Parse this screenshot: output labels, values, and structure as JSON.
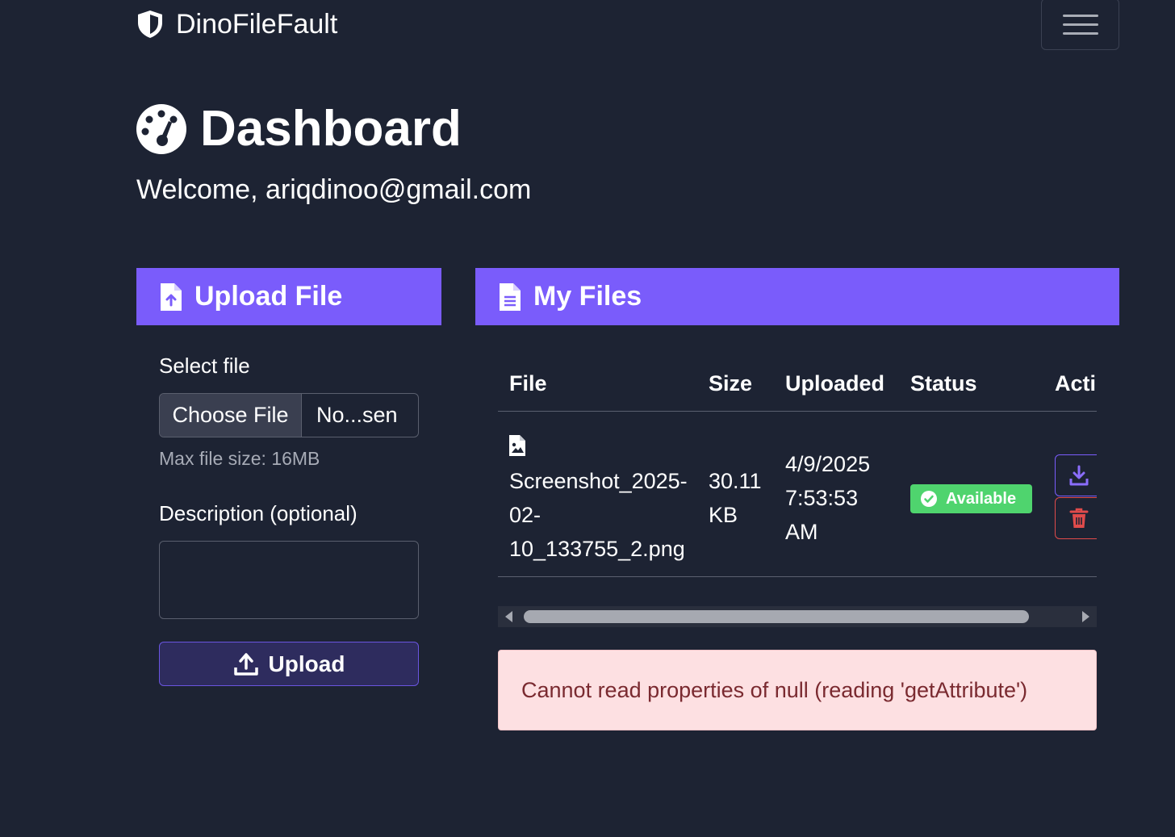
{
  "navbar": {
    "brand": "DinoFileFault",
    "brand_icon": "shield-icon",
    "toggle_icon": "hamburger-icon"
  },
  "page": {
    "title": "Dashboard",
    "title_icon": "gauge-icon",
    "welcome": "Welcome, ariqdinoo@gmail.com"
  },
  "upload_card": {
    "header": "Upload File",
    "header_icon": "file-upload-icon",
    "select_label": "Select file",
    "choose_button": "Choose File",
    "chosen_text": "No...sen",
    "max_size_hint": "Max file size: 16MB",
    "description_label": "Description (optional)",
    "description_value": "",
    "upload_button": "Upload",
    "upload_icon": "upload-icon"
  },
  "files_card": {
    "header": "My Files",
    "header_icon": "file-text-icon",
    "columns": [
      "File",
      "Size",
      "Uploaded",
      "Status",
      "Acti"
    ],
    "rows": [
      {
        "file_icon": "image-file-icon",
        "file_name_lines": [
          "Screenshot_2025-",
          "02-",
          "10_133755_2.png"
        ],
        "size_lines": [
          "30.11",
          "KB"
        ],
        "uploaded_lines": [
          "4/9/2025",
          "7:53:53",
          "AM"
        ],
        "status": "Available",
        "status_icon": "check-circle-icon",
        "actions": [
          "download-icon",
          "trash-icon"
        ]
      }
    ]
  },
  "alert": {
    "message": "Cannot read properties of null (reading 'getAttribute')"
  },
  "colors": {
    "background": "#1d2333",
    "accent": "#7a5cfb",
    "success": "#4fd46e",
    "danger": "#e04b4b",
    "alert_bg": "#fde0e2",
    "alert_text": "#7a2a30"
  }
}
